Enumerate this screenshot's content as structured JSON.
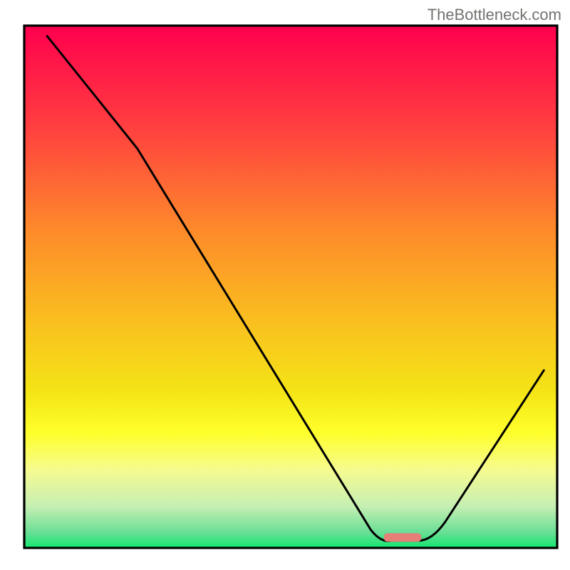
{
  "watermark": "TheBottleneck.com",
  "chart_data": {
    "type": "line",
    "title": "",
    "xlabel": "",
    "ylabel": "",
    "xlim": [
      0,
      100
    ],
    "ylim": [
      0,
      100
    ],
    "curve": {
      "name": "bottleneck-curve",
      "points": [
        {
          "x": 4.3,
          "y": 98.0
        },
        {
          "x": 21.2,
          "y": 76.5
        },
        {
          "x": 65.0,
          "y": 3.5
        },
        {
          "x": 69.0,
          "y": 1.4
        },
        {
          "x": 74.0,
          "y": 1.4
        },
        {
          "x": 79.0,
          "y": 5.0
        },
        {
          "x": 97.5,
          "y": 34.0
        }
      ]
    },
    "bottleneck_marker": {
      "x_start": 67.5,
      "x_end": 74.5,
      "y": 2.0,
      "color": "#e77e77"
    },
    "frame": {
      "x_min": 4.3,
      "x_max": 97.5,
      "y_min": 2.0,
      "y_max": 98.0
    },
    "gradient_bands": [
      {
        "y": 98,
        "color": "#ff004e"
      },
      {
        "y": 80,
        "color": "#ff483d"
      },
      {
        "y": 60,
        "color": "#fe9029"
      },
      {
        "y": 40,
        "color": "#f7d21a"
      },
      {
        "y": 28,
        "color": "#eef013"
      },
      {
        "y": 20,
        "color": "#ffff2b"
      },
      {
        "y": 14,
        "color": "#f4f987"
      },
      {
        "y": 8,
        "color": "#d2f2bd"
      },
      {
        "y": 2,
        "color": "#13e66f"
      }
    ]
  }
}
